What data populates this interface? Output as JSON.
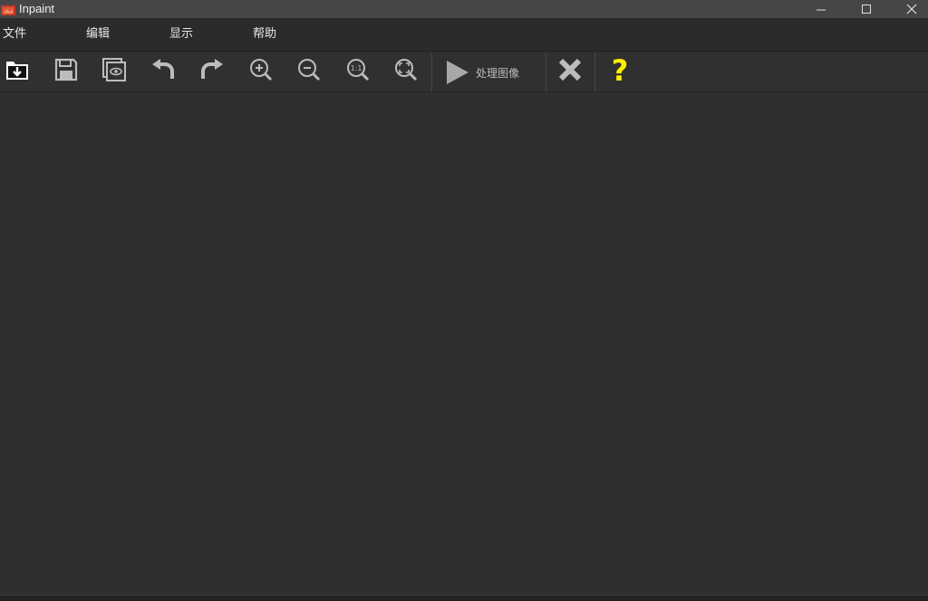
{
  "window": {
    "title": "Inpaint",
    "controls": [
      "minimize-icon",
      "maximize-icon",
      "close-icon"
    ]
  },
  "menu": {
    "items": [
      {
        "label": "文件"
      },
      {
        "label": "编辑"
      },
      {
        "label": "显示"
      },
      {
        "label": "帮助"
      }
    ]
  },
  "toolbar": {
    "buttons": [
      "open-icon",
      "save-icon",
      "preview-icon",
      "undo-icon",
      "redo-icon",
      "zoom-in-icon",
      "zoom-out-icon",
      "zoom-actual-size-icon",
      "zoom-fit-icon"
    ],
    "process_label": "处理图像",
    "clear_icon": "clear-x-icon",
    "help_icon": "help-question-icon"
  },
  "colors": {
    "background": "#2e2e2e",
    "icon": "#bcbcbc",
    "help": "#ffee00",
    "titlebar": "#464646"
  }
}
